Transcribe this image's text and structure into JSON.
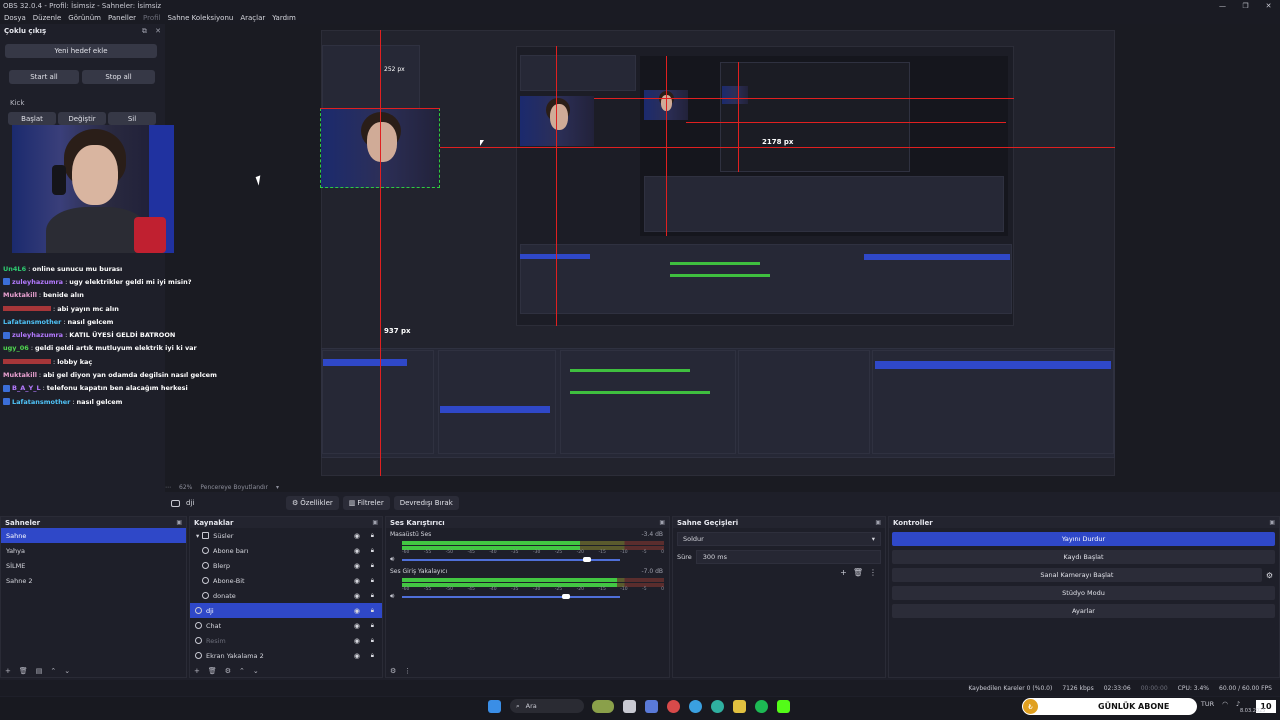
{
  "window": {
    "title": "OBS 32.0.4 - Profil: İsimsiz - Sahneler: İsimsiz",
    "controls": [
      "—",
      "❐",
      "✕"
    ]
  },
  "menu": [
    "Dosya",
    "Düzenle",
    "Görünüm",
    "Paneller",
    "Profil",
    "Sahne Koleksiyonu",
    "Araçlar",
    "Yardım"
  ],
  "multi_output": {
    "title": "Çoklu çıkış",
    "controls": [
      "⧉",
      "✕"
    ],
    "new_target": "Yeni hedef ekle",
    "start_all": "Start all",
    "stop_all": "Stop all",
    "target_name": "Kick",
    "start": "Başlat",
    "edit": "Değiştir",
    "delete": "Sil"
  },
  "chat": [
    {
      "user": "Un4L6",
      "msg": "online sunucu mu burası",
      "color": "#2ecc71",
      "badge": false
    },
    {
      "user": "zuleyhazumra",
      "msg": "ugy elektrikler geldi mi iyi misin?",
      "color": "#b47aff",
      "badge": true
    },
    {
      "user": "Muktakill",
      "msg": "benide alın",
      "color": "#e8a0d0",
      "badge": false
    },
    {
      "user": "",
      "msg": "abi yayın mc alın",
      "color": "#e04040",
      "badge": false
    },
    {
      "user": "Lafatansmother",
      "msg": "nasıl gelcem",
      "color": "#4fc3f7",
      "badge": false
    },
    {
      "user": "zuleyhazumra",
      "msg": "KATIL ÜYESİ GELDİ BATROON",
      "color": "#b47aff",
      "badge": true
    },
    {
      "user": "ugy_06",
      "msg": "geldi geldi artık mutluyum elektrik iyi ki var",
      "color": "#4fd84f",
      "badge": false
    },
    {
      "user": "",
      "msg": "lobby kaç",
      "color": "#e04040",
      "badge": false
    },
    {
      "user": "Muktakill",
      "msg": "abi gel diyon yan odamda degilsin nasıl gelcem",
      "color": "#e8a0d0",
      "badge": false
    },
    {
      "user": "B_A_Y_L",
      "msg": "telefonu kapatın ben alacağım herkesi",
      "color": "#b47aff",
      "badge": true
    },
    {
      "user": "Lafatansmother",
      "msg": "nasıl gelcem",
      "color": "#4fc3f7",
      "badge": true
    }
  ],
  "preview": {
    "measure_top": "252 px",
    "measure_right": "2178 px",
    "measure_bottom": "937 px",
    "zoom": "62%",
    "fit": "Pencereye Boyutlandır"
  },
  "source_bar": {
    "selected_source": "dji",
    "properties": "Özellikler",
    "filters": "Filtreler",
    "deactivate": "Devredışı Bırak"
  },
  "scenes": {
    "title": "Sahneler",
    "items": [
      "Sahne",
      "Yahya",
      "SİLME",
      "Sahne 2"
    ],
    "selected_index": 0,
    "footer": [
      "+",
      "🗑",
      "▤",
      "⌃",
      "⌄"
    ]
  },
  "sources": {
    "title": "Kaynaklar",
    "items": [
      {
        "label": "Süsler",
        "type": "folder",
        "indent": false,
        "dim": false
      },
      {
        "label": "Abone barı",
        "type": "src",
        "indent": true,
        "dim": false
      },
      {
        "label": "Blerp",
        "type": "src",
        "indent": true,
        "dim": false
      },
      {
        "label": "Abone-Bit",
        "type": "src",
        "indent": true,
        "dim": false
      },
      {
        "label": "donate",
        "type": "src",
        "indent": true,
        "dim": false
      },
      {
        "label": "dji",
        "type": "cam",
        "indent": false,
        "dim": false
      },
      {
        "label": "Chat",
        "type": "src",
        "indent": false,
        "dim": false
      },
      {
        "label": "Resim",
        "type": "src",
        "indent": false,
        "dim": true
      },
      {
        "label": "Ekran Yakalama 2",
        "type": "src",
        "indent": false,
        "dim": false
      }
    ],
    "selected_index": 5,
    "footer": [
      "+",
      "🗑",
      "⚙",
      "⌃",
      "⌄"
    ]
  },
  "mixer": {
    "title": "Ses Karıştırıcı",
    "channels": [
      {
        "name": "Masaüstü Ses",
        "db": "-3.4 dB",
        "level": 0.68,
        "volume": 0.85
      },
      {
        "name": "Ses Giriş Yakalayıcı",
        "db": "-7.0 dB",
        "level": 0.82,
        "volume": 0.75
      }
    ],
    "ticks": [
      "-60",
      "-55",
      "-50",
      "-45",
      "-40",
      "-35",
      "-30",
      "-25",
      "-20",
      "-15",
      "-10",
      "-5",
      "0"
    ],
    "footer": [
      "⚙",
      "⋮"
    ]
  },
  "transitions": {
    "title": "Sahne Geçişleri",
    "selected": "Soldur",
    "duration_label": "Süre",
    "duration_value": "300 ms",
    "footer": [
      "+",
      "🗑",
      "⋮"
    ]
  },
  "controls": {
    "title": "Kontroller",
    "stream": "Yayını Durdur",
    "record": "Kaydı Başlat",
    "virtual_cam": "Sanal Kamerayı Başlat",
    "studio": "Stüdyo Modu",
    "settings": "Ayarlar"
  },
  "status": {
    "dropped": "Kaybedilen Kareler 0 (%0.0)",
    "bitrate": "7126 kbps",
    "stream_time": "02:33:06",
    "record_time": "00:00:00",
    "cpu": "CPU: 3.4%",
    "fps": "60.00 / 60.00 FPS"
  },
  "taskbar": {
    "search": "Ara",
    "tray_lang": "TUR",
    "abone_text": "GÜNLÜK ABONE",
    "abone_count": "10",
    "date": "8.03.2025"
  },
  "colors": {
    "accent": "#2f48c8",
    "bg": "#1e1f29",
    "guide_red": "#e02020",
    "meter_green": "#42c642"
  }
}
